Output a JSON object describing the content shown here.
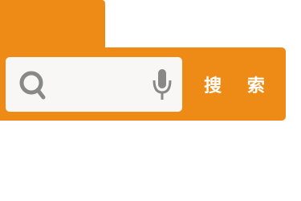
{
  "search": {
    "button_label": "搜 索",
    "value": "",
    "placeholder": ""
  },
  "icons": {
    "search": "search-icon",
    "mic": "microphone-icon"
  },
  "colors": {
    "accent": "#ee8a16",
    "field_background": "#f9f7f5",
    "icon": "#888888",
    "button_text": "#ffffff"
  }
}
